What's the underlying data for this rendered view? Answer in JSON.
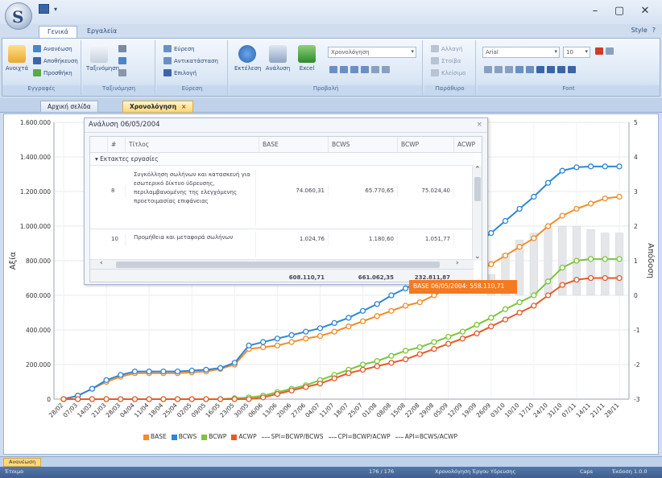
{
  "window": {
    "minimize": "–",
    "maximize": "▢",
    "close": "✕",
    "orb_glyph": "S"
  },
  "ribbon_tabs": [
    "Γενικά",
    "Εργαλεία"
  ],
  "right_controls": [
    "Style",
    "?"
  ],
  "ribbon": {
    "groups": [
      {
        "label": "Εγγραφές"
      },
      {
        "label": "Ταξινόμηση"
      },
      {
        "label": "Εύρεση"
      },
      {
        "label": "Προβολή"
      },
      {
        "label": "Παράθυρο"
      },
      {
        "label": "Font"
      }
    ],
    "buttons": {
      "new": "Ανοιχτά",
      "records_small": [
        "Ανανέωση",
        "Αποθήκευση",
        "Προσθήκη"
      ],
      "sort": "Ταξινόμηση",
      "find_small": [
        "Εύρεση",
        "Αντικατάσταση",
        "Επιλογή"
      ],
      "run": "Εκτέλεση",
      "analysis": "Ανάλυση",
      "excel": "Excel",
      "view_combo": "Χρονολόγηση",
      "window_small": [
        "Αλλαγή",
        "Στοίβα",
        "Κλείσιμο"
      ],
      "font_name": "Arial",
      "font_size": "10"
    }
  },
  "doc_tabs": [
    {
      "label": "Αρχική σελίδα",
      "active": false
    },
    {
      "label": "Χρονολόγηση",
      "active": true
    }
  ],
  "popup": {
    "title": "Ανάλυση 06/05/2004",
    "close": "×",
    "columns": [
      "#",
      "Τίτλος",
      "BASE",
      "BCWS",
      "BCWP",
      "ACWP"
    ],
    "group": "Εκτακτες εργασίες",
    "rows": [
      {
        "id": "8",
        "title": "Συγκόλληση σωλήνων και κατασκευή για εσωτερικό δίκτυο ύδρευσης, περιλαμβανομένης της ελεγχόμενης προετοιμασίας επιφάνειας",
        "base": "74.060,31",
        "bcws": "65.770,65",
        "bcwp": "75.024,40",
        "acwp": ""
      },
      {
        "id": "10",
        "title": "Προμήθεια και μεταφορά σωλήνων",
        "base": "1.024,76",
        "bcws": "1.180,60",
        "bcwp": "1.051,77",
        "acwp": ""
      }
    ],
    "totals": {
      "base": "608.110,71",
      "bcws": "661.062,35",
      "bcwp": "232.811,87"
    }
  },
  "tooltip": "BASE 06/05/2004: 558.110,71",
  "chart_data": {
    "type": "line",
    "ylabel": "Αξία",
    "y2label": "Απόδοση",
    "ylim": [
      0,
      1600000
    ],
    "y_ticks": [
      "0",
      "200.000",
      "400.000",
      "600.000",
      "800.000",
      "1.000.000",
      "1.200.000",
      "1.400.000",
      "1.600.000"
    ],
    "y2lim": [
      -3,
      5
    ],
    "y2_ticks": [
      "-3",
      "-2",
      "-1",
      "0",
      "1",
      "2",
      "3",
      "4",
      "5"
    ],
    "x": [
      "28/02",
      "07/03",
      "14/03",
      "21/03",
      "28/03",
      "04/04",
      "11/04",
      "18/04",
      "25/04",
      "02/05",
      "09/05",
      "16/05",
      "23/05",
      "30/05",
      "06/06",
      "13/06",
      "20/06",
      "27/06",
      "04/07",
      "11/07",
      "18/07",
      "25/07",
      "01/08",
      "08/08",
      "15/08",
      "22/08",
      "29/08",
      "05/09",
      "12/09",
      "19/09",
      "26/09",
      "03/10",
      "10/10",
      "17/10",
      "24/10",
      "31/10",
      "07/11",
      "14/11",
      "21/11",
      "28/11"
    ],
    "series": [
      {
        "name": "BASE",
        "color": "#f28c28",
        "values": [
          0,
          20000,
          60000,
          100000,
          130000,
          150000,
          150000,
          150000,
          150000,
          155000,
          160000,
          175000,
          200000,
          290000,
          300000,
          310000,
          330000,
          350000,
          365000,
          390000,
          420000,
          450000,
          480000,
          510000,
          540000,
          560000,
          600000,
          640000,
          690000,
          730000,
          780000,
          830000,
          880000,
          930000,
          1000000,
          1060000,
          1100000,
          1130000,
          1160000,
          1170000
        ]
      },
      {
        "name": "BCWS",
        "color": "#2f86d8",
        "values": [
          0,
          20000,
          60000,
          110000,
          140000,
          160000,
          160000,
          160000,
          160000,
          165000,
          170000,
          180000,
          210000,
          310000,
          330000,
          350000,
          370000,
          390000,
          410000,
          440000,
          470000,
          510000,
          550000,
          600000,
          640000,
          680000,
          730000,
          780000,
          840000,
          900000,
          960000,
          1030000,
          1100000,
          1170000,
          1250000,
          1320000,
          1340000,
          1345000,
          1345000,
          1345000
        ]
      },
      {
        "name": "BCWP",
        "color": "#7cc63a",
        "values": [
          0,
          0,
          0,
          0,
          0,
          0,
          0,
          0,
          0,
          0,
          0,
          0,
          5000,
          10000,
          20000,
          40000,
          60000,
          80000,
          110000,
          140000,
          170000,
          200000,
          220000,
          250000,
          280000,
          300000,
          330000,
          360000,
          390000,
          430000,
          470000,
          520000,
          560000,
          600000,
          680000,
          760000,
          800000,
          810000,
          810000,
          810000
        ]
      },
      {
        "name": "ACWP",
        "color": "#e55a2b",
        "values": [
          0,
          0,
          0,
          0,
          0,
          0,
          0,
          0,
          0,
          0,
          0,
          0,
          0,
          0,
          10000,
          30000,
          50000,
          70000,
          90000,
          120000,
          150000,
          170000,
          190000,
          210000,
          230000,
          260000,
          290000,
          320000,
          350000,
          380000,
          420000,
          460000,
          500000,
          540000,
          600000,
          660000,
          690000,
          700000,
          700000,
          700000
        ]
      }
    ],
    "index_series": [
      "SPI=BCWP/BCWS",
      "CPI=BCWP/ACWP",
      "API=BCWS/ACWP"
    ],
    "background_bars": [
      0,
      0,
      0,
      0,
      0,
      0,
      0,
      0,
      0,
      0,
      0,
      0,
      0,
      0,
      0,
      0,
      0,
      0,
      0,
      0,
      0,
      0,
      0,
      0,
      0,
      0,
      0,
      0,
      0,
      0,
      0.6,
      1.2,
      1.6,
      1.8,
      2.0,
      2.0,
      2.0,
      1.9,
      1.8,
      1.8
    ],
    "legend_position": "bottom"
  },
  "bottom_tab": "Ανανέωση",
  "status": {
    "left": "Έτοιμο",
    "middle": "176 / 176",
    "right1": "Χρονολόγηση Έργου Υδρευσης",
    "right2": "Caps",
    "right3": "Έκδοση 1.0.0"
  }
}
